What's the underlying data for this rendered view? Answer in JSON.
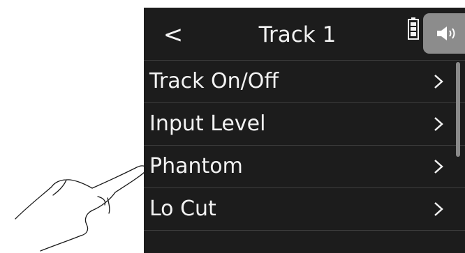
{
  "header": {
    "back_glyph": "<",
    "title": "Track 1"
  },
  "status": {
    "battery_icon": "battery-icon",
    "speaker_icon": "speaker-icon"
  },
  "menu": {
    "items": [
      {
        "label": "Track On/Off"
      },
      {
        "label": "Input Level"
      },
      {
        "label": "Phantom"
      },
      {
        "label": "Lo Cut"
      }
    ]
  },
  "colors": {
    "screen_bg": "#1c1c1c",
    "text": "#f2f2f2",
    "divider": "#3d3d3d",
    "speaker_tab": "#8c8c8c"
  }
}
